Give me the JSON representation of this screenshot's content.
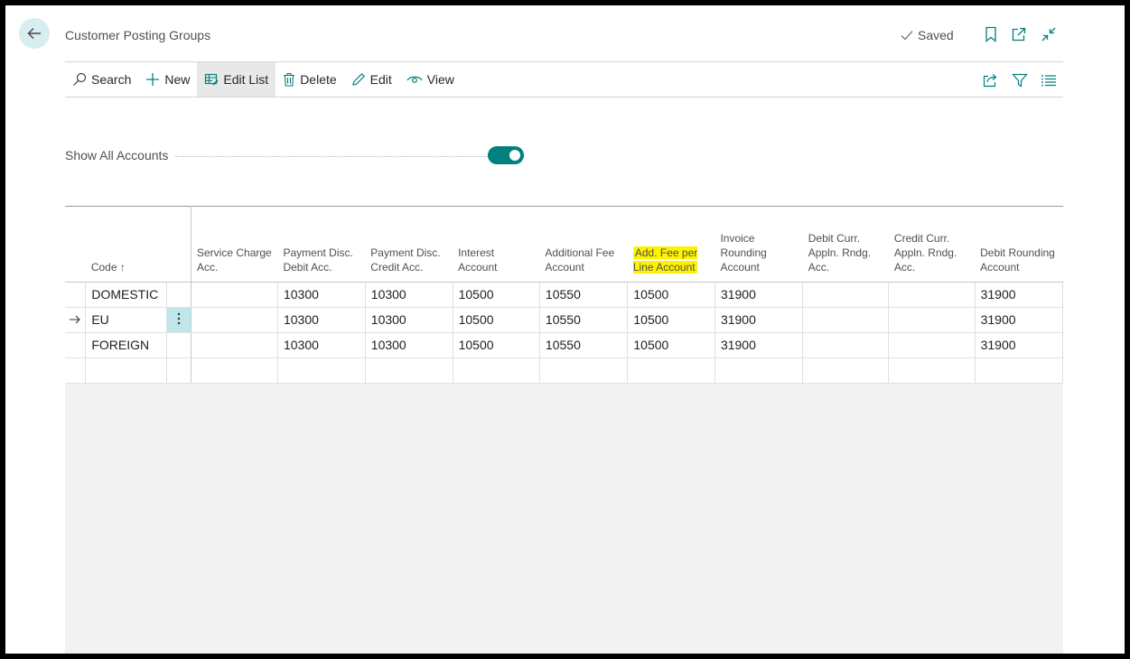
{
  "page": {
    "title": "Customer Posting Groups",
    "saved_label": "Saved"
  },
  "toolbar": {
    "search": "Search",
    "new": "New",
    "edit_list": "Edit List",
    "delete": "Delete",
    "edit": "Edit",
    "view": "View"
  },
  "toggle": {
    "label": "Show All Accounts",
    "on": true
  },
  "table": {
    "columns": [
      "Code ↑",
      "Service Charge Acc.",
      "Payment Disc. Debit Acc.",
      "Payment Disc. Credit Acc.",
      "Interest Account",
      "Additional Fee Account",
      "Add. Fee per Line Account",
      "Invoice Rounding Account",
      "Debit Curr. Appln. Rndg. Acc.",
      "Credit Curr. Appln. Rndg. Acc.",
      "Debit Rounding Account"
    ],
    "rows": [
      [
        "DOMESTIC",
        "",
        "10300",
        "10300",
        "10500",
        "10550",
        "10500",
        "31900",
        "",
        "",
        "31900"
      ],
      [
        "EU",
        "",
        "10300",
        "10300",
        "10500",
        "10550",
        "10500",
        "31900",
        "",
        "",
        "31900"
      ],
      [
        "FOREIGN",
        "",
        "10300",
        "10300",
        "10500",
        "10550",
        "10500",
        "31900",
        "",
        "",
        "31900"
      ]
    ],
    "current_row_index": 1
  },
  "colors": {
    "accent": "#00807f",
    "back_button_bg": "#d8edf0",
    "highlight": "#fff200",
    "row_menu_bg": "#bfe6ea"
  }
}
